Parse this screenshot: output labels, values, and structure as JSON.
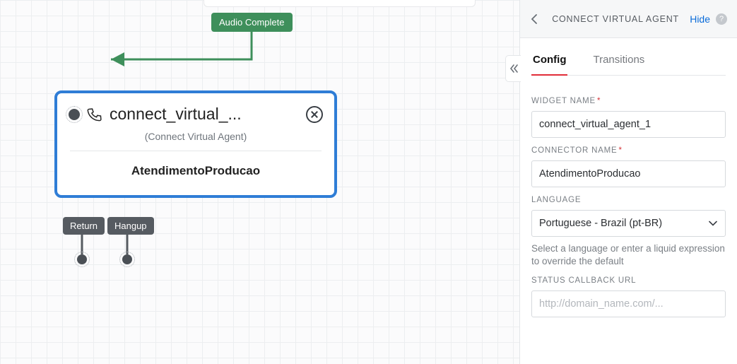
{
  "source_pill": {
    "label": "Audio Complete"
  },
  "node": {
    "title": "connect_virtual_...",
    "subtitle": "(Connect Virtual Agent)",
    "connector_display": "AtendimentoProducao",
    "outputs": [
      {
        "name": "return",
        "label": "Return"
      },
      {
        "name": "hangup",
        "label": "Hangup"
      }
    ]
  },
  "panel": {
    "header": {
      "title": "CONNECT VIRTUAL AGENT",
      "hide": "Hide",
      "help_glyph": "?"
    },
    "tabs": {
      "config": "Config",
      "transitions": "Transitions"
    },
    "fields": {
      "widget_name": {
        "label": "WIDGET NAME",
        "value": "connect_virtual_agent_1"
      },
      "connector_name": {
        "label": "CONNECTOR NAME",
        "value": "AtendimentoProducao"
      },
      "language": {
        "label": "LANGUAGE",
        "value": "Portuguese - Brazil (pt-BR)",
        "helper": "Select a language or enter a liquid expression to override the default"
      },
      "status_callback": {
        "label": "STATUS CALLBACK URL",
        "placeholder": "http://domain_name.com/..."
      }
    }
  },
  "colors": {
    "accent_blue": "#2f7dd6",
    "green": "#3e8f5b",
    "tab_underline": "#e12d39"
  }
}
